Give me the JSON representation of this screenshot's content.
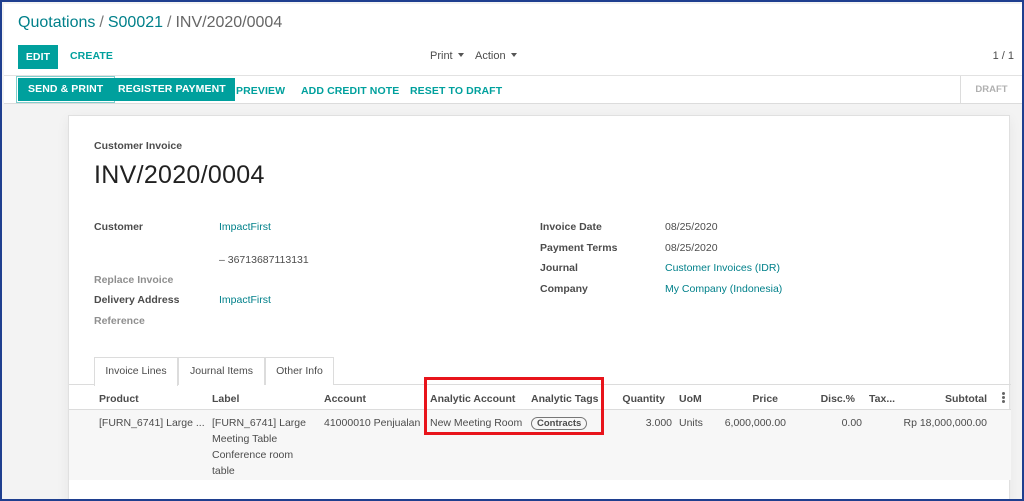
{
  "breadcrumb": {
    "root": "Quotations",
    "order": "S00021",
    "current": "INV/2020/0004",
    "sep": "/"
  },
  "toolbar": {
    "edit_label": "EDIT",
    "create_label": "CREATE",
    "print_label": "Print",
    "action_label": "Action",
    "pager": "1 / 1"
  },
  "statusbar": {
    "send_print": "SEND & PRINT",
    "register_payment": "REGISTER PAYMENT",
    "preview": "PREVIEW",
    "add_credit_note": "ADD CREDIT NOTE",
    "reset_to_draft": "RESET TO DRAFT",
    "state": "DRAFT"
  },
  "invoice": {
    "type": "Customer Invoice",
    "name": "INV/2020/0004",
    "left": {
      "customer_label": "Customer",
      "customer": "ImpactFirst",
      "vat": "– 36713687113131",
      "replace_invoice_label": "Replace Invoice",
      "delivery_label": "Delivery Address",
      "delivery": "ImpactFirst",
      "reference_label": "Reference"
    },
    "right": {
      "date_label": "Invoice Date",
      "date": "08/25/2020",
      "terms_label": "Payment Terms",
      "terms": "08/25/2020",
      "journal_label": "Journal",
      "journal": "Customer Invoices (IDR)",
      "company_label": "Company",
      "company": "My Company (Indonesia)"
    }
  },
  "tabs": [
    "Invoice Lines",
    "Journal Items",
    "Other Info"
  ],
  "lines": {
    "headers": [
      "Product",
      "Label",
      "Account",
      "Analytic Account",
      "Analytic Tags",
      "Quantity",
      "UoM",
      "Price",
      "Disc.%",
      "Tax...",
      "Subtotal"
    ],
    "rows": [
      {
        "product": "[FURN_6741] Large ...",
        "label": "[FURN_6741] Large Meeting Table Conference room table",
        "account": "41000010 Penjualan",
        "analytic_account": "New Meeting Room",
        "analytic_tag": "Contracts",
        "quantity": "3.000",
        "uom": "Units",
        "price": "6,000,000.00",
        "discount": "0.00",
        "tax": "",
        "subtotal": "Rp 18,000,000.00"
      }
    ]
  },
  "colors": {
    "accent": "#00a09d",
    "link": "#00808a",
    "highlight": "#e8141b",
    "frame": "#1f3f8f"
  }
}
